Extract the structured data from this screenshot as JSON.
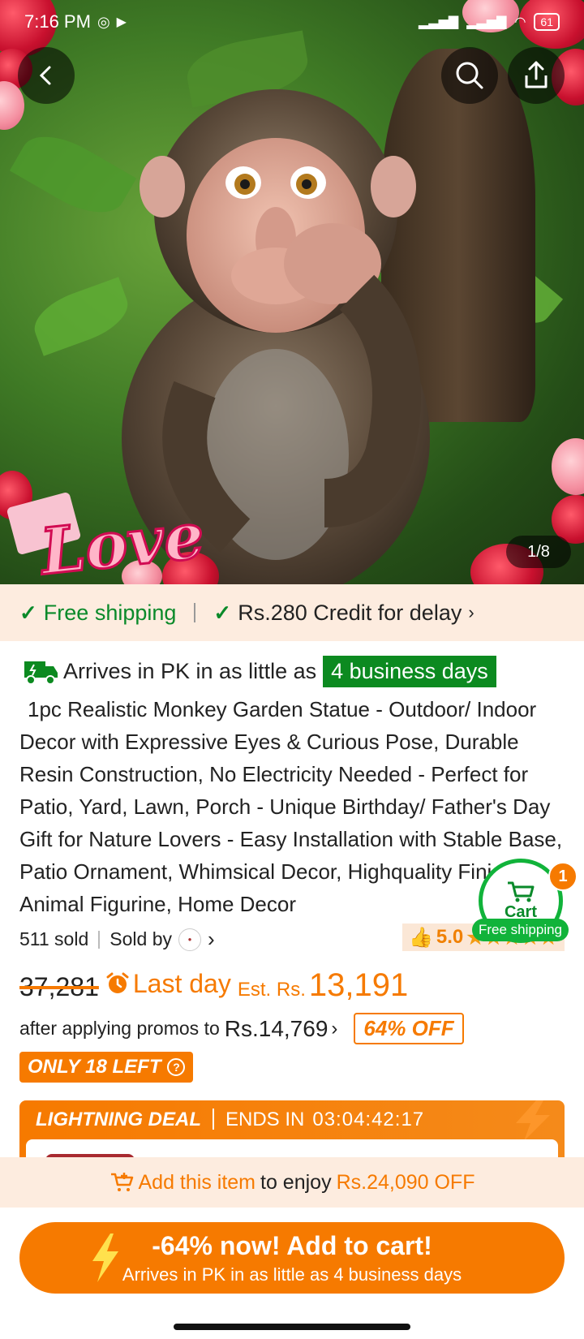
{
  "status_bar": {
    "time": "7:16 PM",
    "battery": "61"
  },
  "gallery": {
    "counter": "1/8",
    "overlay_text": "Love"
  },
  "shipping_strip": {
    "free_shipping": "Free shipping",
    "credit": "Rs.280 Credit for delay"
  },
  "delivery": {
    "prefix": "Arrives in PK in as little as",
    "badge": "4 business days"
  },
  "product": {
    "title": "1pc Realistic Monkey Garden Statue - Outdoor/ Indoor Decor with Expressive Eyes & Curious Pose, Durable Resin Construction, No Electricity Needed - Perfect for Patio, Yard, Lawn, Porch - Unique Birthday/ Father's Day Gift for Nature Lovers - Easy Installation with Stable Base, Patio Ornament, Whimsical Decor, Highquality Finish, Animal Figurine, Home Decor",
    "sold": "511 sold",
    "sold_by": "Sold by",
    "rating": "5.0",
    "stars": "★★★★★",
    "stars_value": 5
  },
  "cart": {
    "label": "Cart",
    "count": "1",
    "free_shipping": "Free shipping"
  },
  "price": {
    "original": "37,281",
    "last_day": "Last day",
    "est_label": "Est. Rs.",
    "final": "13,191",
    "promo_prefix": "after applying promos to",
    "promo_price": "Rs.14,769",
    "off_badge": "64% OFF",
    "stock_badge": "ONLY 18 LEFT"
  },
  "deal": {
    "title": "LIGHTNING DEAL",
    "ends_label": "ENDS IN",
    "countdown": "03:04:42:17"
  },
  "enjoy_bar": {
    "action": "Add this item",
    "middle": "to enjoy",
    "amount": "Rs.24,090 OFF"
  },
  "cta": {
    "main": "-64% now! Add to cart!",
    "sub": "Arrives in PK in as little as 4 business days"
  },
  "colors": {
    "accent": "#f67a00",
    "green": "#0a8a2a",
    "badge_green": "#0c8a20",
    "strip_bg": "#fdecdf"
  }
}
